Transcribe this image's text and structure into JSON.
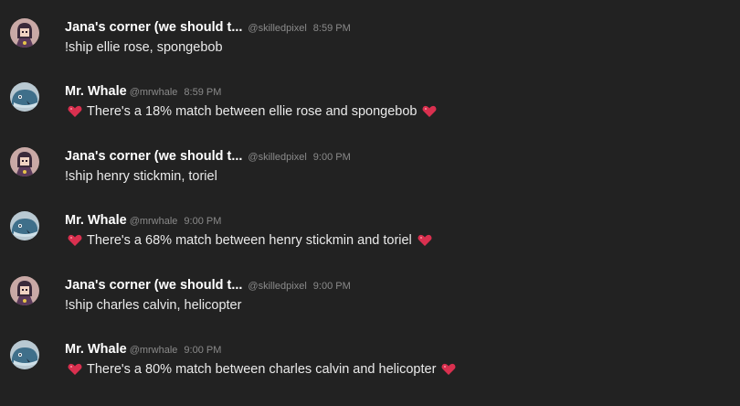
{
  "messages": [
    {
      "username": "Jana's corner (we should t...",
      "handle": "@skilledpixel",
      "time": "8:59 PM",
      "text": "!ship ellie rose, spongebob",
      "avatar": "jana-avatar"
    },
    {
      "username": "Mr. Whale",
      "handle": "@mrwhale",
      "time": "8:59 PM",
      "text": "There's a 18% match between ellie rose and spongebob",
      "avatar": "whale-avatar",
      "hearts": true
    },
    {
      "username": "Jana's corner (we should t...",
      "handle": "@skilledpixel",
      "time": "9:00 PM",
      "text": "!ship henry stickmin, toriel",
      "avatar": "jana-avatar"
    },
    {
      "username": "Mr. Whale",
      "handle": "@mrwhale",
      "time": "9:00 PM",
      "text": "There's a 68% match between henry stickmin and toriel",
      "avatar": "whale-avatar",
      "hearts": true
    },
    {
      "username": "Jana's corner (we should t...",
      "handle": "@skilledpixel",
      "time": "9:00 PM",
      "text": "!ship charles calvin, helicopter",
      "avatar": "jana-avatar"
    },
    {
      "username": "Mr. Whale",
      "handle": "@mrwhale",
      "time": "9:00 PM",
      "text": "There's a 80% match between charles calvin and helicopter",
      "avatar": "whale-avatar",
      "hearts": true
    }
  ],
  "colors": {
    "background": "#222222",
    "username": "#ffffff",
    "meta": "#8a8a8a",
    "heart": "#d9304f"
  }
}
